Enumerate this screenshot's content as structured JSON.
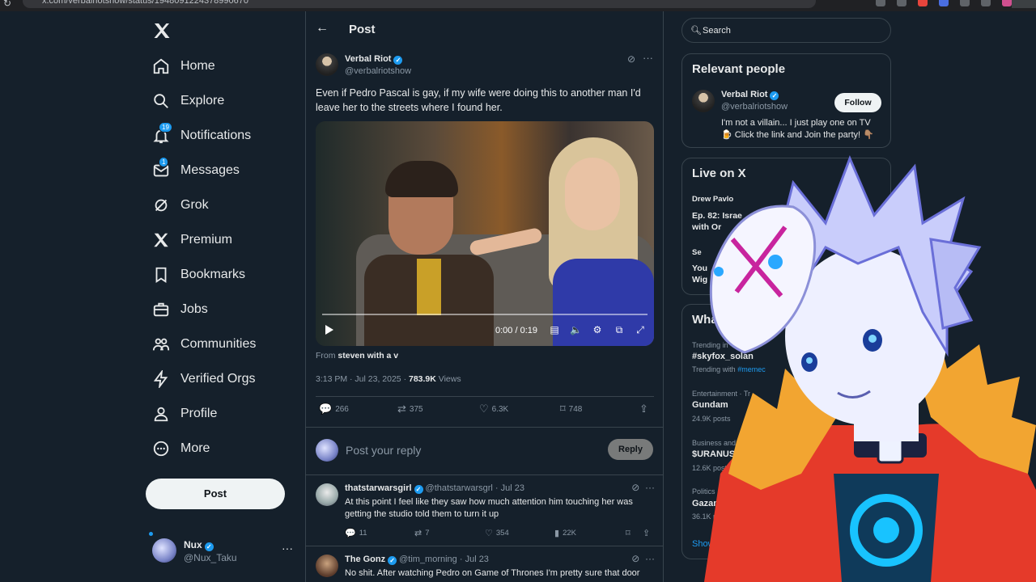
{
  "browser": {
    "url": "x.com/verbalriotshow/status/1948091224378990670"
  },
  "nav": {
    "items": [
      {
        "label": "Home",
        "icon": "home-icon"
      },
      {
        "label": "Explore",
        "icon": "search-icon"
      },
      {
        "label": "Notifications",
        "icon": "bell-icon",
        "badge": "19"
      },
      {
        "label": "Messages",
        "icon": "envelope-icon",
        "badge": "1"
      },
      {
        "label": "Grok",
        "icon": "grok-icon"
      },
      {
        "label": "Premium",
        "icon": "x-icon"
      },
      {
        "label": "Bookmarks",
        "icon": "bookmark-icon"
      },
      {
        "label": "Jobs",
        "icon": "briefcase-icon"
      },
      {
        "label": "Communities",
        "icon": "people-icon"
      },
      {
        "label": "Verified Orgs",
        "icon": "lightning-icon"
      },
      {
        "label": "Profile",
        "icon": "person-icon"
      },
      {
        "label": "More",
        "icon": "more-circle-icon"
      }
    ],
    "post_label": "Post",
    "account": {
      "name": "Nux",
      "handle": "@Nux_Taku"
    }
  },
  "post": {
    "header_title": "Post",
    "author_name": "Verbal Riot",
    "author_handle": "@verbalriotshow",
    "text": "Even if Pedro Pascal is gay, if my wife were doing this to another man I'd leave her to the streets where I found her.",
    "video_time": "0:00 / 0:19",
    "video_progress": 0,
    "from_prefix": "From",
    "from_source": "steven with a v",
    "timestamp": "3:13 PM · Jul 23, 2025 · ",
    "views_count": "783.9K",
    "views_label": " Views",
    "replies": "266",
    "reposts": "375",
    "likes": "6.3K",
    "bookmarks": "748",
    "reply_placeholder": "Post your reply",
    "reply_button": "Reply"
  },
  "replies": [
    {
      "name": "thatstarwarsgirl",
      "handle": "@thatstarwarsgrl · Jul 23",
      "text": "At this point I feel like they saw how much attention him touching her was getting the studio told them to turn it up",
      "replies": "11",
      "reposts": "7",
      "likes": "354",
      "views": "22K"
    },
    {
      "name": "The Gonz",
      "handle": "@tim_morning · Jul 23",
      "text": "No shit. After watching Pedro on Game of Thrones I'm pretty sure that door"
    }
  ],
  "sidebar": {
    "search_placeholder": "Search",
    "relevant_title": "Relevant people",
    "relevant": {
      "name": "Verbal Riot",
      "handle": "@verbalriotshow",
      "follow_label": "Follow",
      "bio": "I'm not a villain... I just play one on TV 🍺 Click the link and Join the party! 👇🏽"
    },
    "live_title": "Live on X",
    "live": [
      {
        "host": "Drew Pavlo",
        "title": "Ep. 82: Israe",
        "title2": "with Or"
      },
      {
        "host": "Se",
        "title": "You",
        "title2": "Wig"
      }
    ],
    "whats_title": "Wha",
    "trends": [
      {
        "category": "Trending in",
        "name": "#skyfox_solan",
        "extra_prefix": "Trending with",
        "extra_tag": "#memec"
      },
      {
        "category": "Entertainment · Tr",
        "name": "Gundam",
        "count": "24.9K posts"
      },
      {
        "category": "Business and",
        "name": "$URANUS",
        "count": "12.6K posts"
      },
      {
        "category": "Politics · Tre",
        "name": "Gazans",
        "count": "36.1K po"
      }
    ],
    "show_more": "Show"
  },
  "colors": {
    "background": "#15202b",
    "accent": "#1d9bf0",
    "border": "#38444d",
    "text_muted": "#8b98a5"
  }
}
